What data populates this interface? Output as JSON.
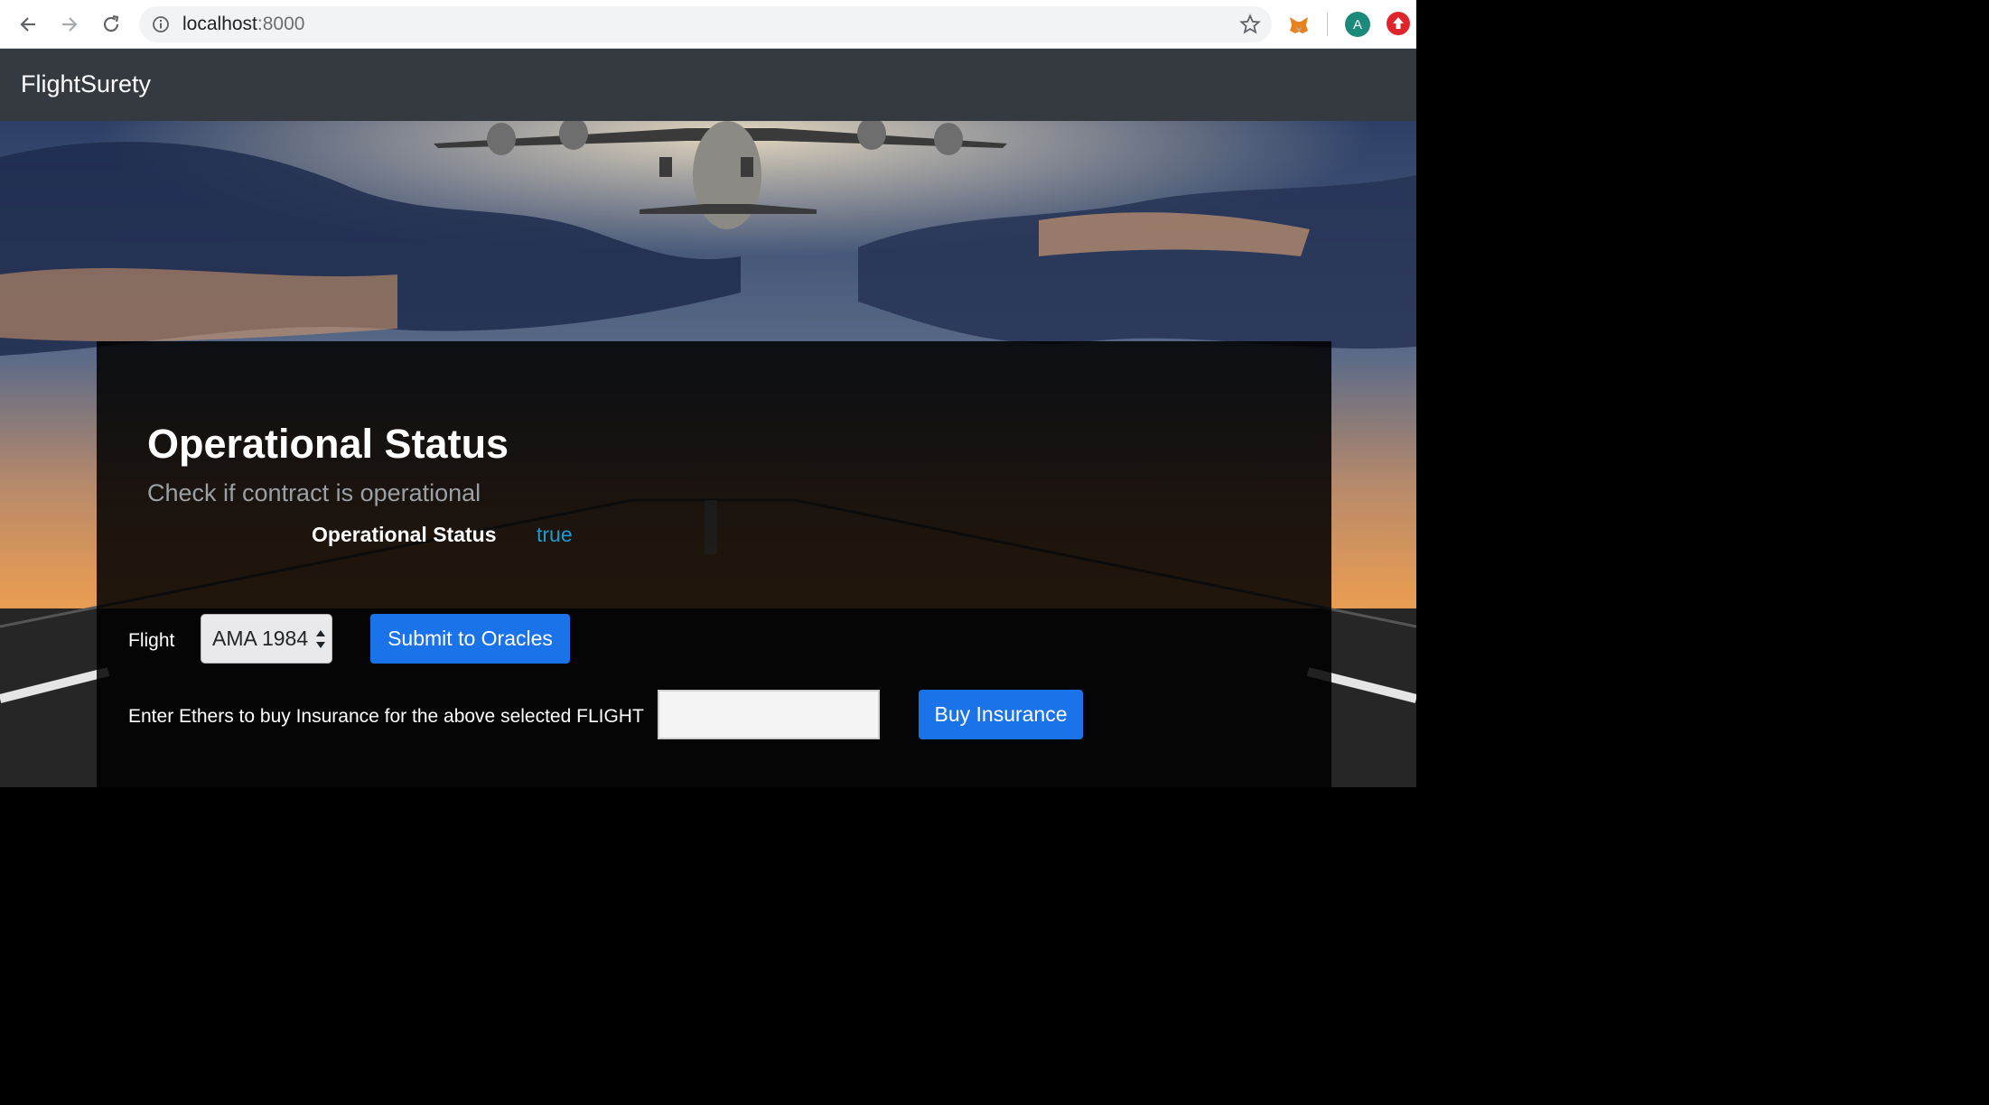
{
  "browser": {
    "url_host": "localhost",
    "url_port": ":8000",
    "profile_initial": "A",
    "icons": [
      "back-arrow-icon",
      "forward-arrow-icon",
      "reload-icon",
      "info-icon",
      "star-icon",
      "metamask-fox-icon",
      "extension-red-icon"
    ]
  },
  "navbar": {
    "brand": "FlightSurety"
  },
  "status_section": {
    "title": "Operational Status",
    "subtitle": "Check if contract is operational",
    "status_label": "Operational Status",
    "status_value": "true"
  },
  "flight_form": {
    "flight_label": "Flight",
    "flight_selected": "AMA 1984",
    "submit_label": "Submit to Oracles"
  },
  "insurance_form": {
    "label": "Enter Ethers to buy Insurance for the above selected FLIGHT",
    "input_value": "",
    "buy_label": "Buy Insurance"
  },
  "colors": {
    "navbar_bg": "#343a40",
    "accent_blue": "#1a73e8",
    "status_true": "#1d9bd1"
  }
}
